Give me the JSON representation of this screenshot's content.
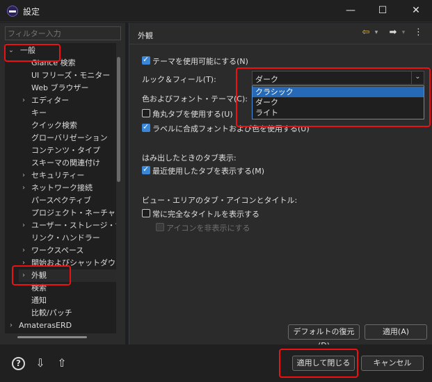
{
  "window": {
    "title": "設定",
    "minimize_glyph": "—",
    "maximize_glyph": "☐",
    "close_glyph": "✕"
  },
  "sidebar": {
    "filter_placeholder": "フィルター入力",
    "tree": [
      {
        "label": "一般",
        "expander": "⌄"
      },
      {
        "label": "Glance 検索",
        "expander": ""
      },
      {
        "label": "UI フリーズ・モニター",
        "expander": ""
      },
      {
        "label": "Web ブラウザー",
        "expander": ""
      },
      {
        "label": "エディター",
        "expander": "›"
      },
      {
        "label": "キー",
        "expander": ""
      },
      {
        "label": "クイック検索",
        "expander": ""
      },
      {
        "label": "グローバリゼーション",
        "expander": ""
      },
      {
        "label": "コンテンツ・タイプ",
        "expander": ""
      },
      {
        "label": "スキーマの関連付け",
        "expander": ""
      },
      {
        "label": "セキュリティー",
        "expander": "›"
      },
      {
        "label": "ネットワーク接続",
        "expander": "›"
      },
      {
        "label": "パースペクティブ",
        "expander": ""
      },
      {
        "label": "プロジェクト・ネーチャー",
        "expander": ""
      },
      {
        "label": "ユーザー・ストレージ・サー",
        "expander": "›"
      },
      {
        "label": "リンク・ハンドラー",
        "expander": ""
      },
      {
        "label": "ワークスペース",
        "expander": "›"
      },
      {
        "label": "開始およびシャットダウン",
        "expander": "›"
      },
      {
        "label": "外観",
        "expander": "›"
      },
      {
        "label": "検索",
        "expander": ""
      },
      {
        "label": "通知",
        "expander": ""
      },
      {
        "label": "比較/パッチ",
        "expander": ""
      },
      {
        "label": "AmaterasERD",
        "expander": "›"
      }
    ]
  },
  "main": {
    "page_title": "外観",
    "nav_back": "⇦",
    "nav_forward": "➡",
    "nav_menu": "⋮",
    "nav_dropdown": "▾",
    "enable_theme_label": "テーマを使用可能にする(N)",
    "look_and_feel_label": "ルック＆フィール(T):",
    "look_and_feel_value": "ダーク",
    "combo_arrow": "⌄",
    "look_and_feel_options": [
      "クラシック",
      "ダーク",
      "ライト"
    ],
    "color_font_theme_label": "色およびフォント・テーマ(C):",
    "rounded_tabs_label": "角丸タブを使用する(U)",
    "label_font_color_label": "ラベルに合成フォントおよび色を使用する(U)",
    "overflow_heading": "はみ出したときのタブ表示:",
    "show_recent_tabs_label": "最近使用したタブを表示する(M)",
    "view_area_heading": "ビュー・エリアのタブ・アイコンとタイトル:",
    "show_full_title_label": "常に完全なタイトルを表示する",
    "hide_icons_label": "アイコンを非表示にする",
    "restore_defaults": "デフォルトの復元(D)",
    "apply": "適用(A)"
  },
  "footer": {
    "help_glyph": "?",
    "import_glyph": "⇩",
    "export_glyph": "⇧",
    "apply_and_close": "適用して閉じる",
    "cancel": "キャンセル"
  },
  "colors": {
    "accent": "#3a87d8",
    "selection": "#2669b6",
    "highlight_box": "#ee1111"
  }
}
